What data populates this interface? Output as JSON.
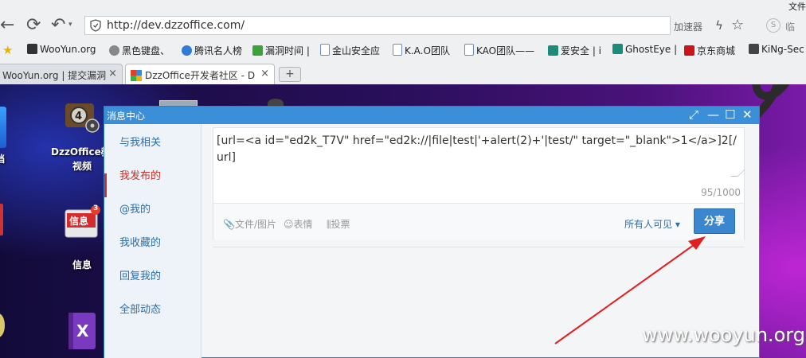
{
  "browser": {
    "menu_right": "文件",
    "url": "http://dev.dzzoffice.com/",
    "accelerator_label": "加速器",
    "right_text": "临",
    "bookmarks": [
      {
        "label": "WooYun.org",
        "color": "#333"
      },
      {
        "label": "黑色键盘、",
        "color": "#777"
      },
      {
        "label": "腾讯名人榜",
        "color": "#2f7bd6"
      },
      {
        "label": "漏洞时间 |",
        "color": "#3aa33a"
      },
      {
        "label": "金山安全应",
        "color": "#6b8cc7"
      },
      {
        "label": "K.A.O团队",
        "color": "#6b8cc7"
      },
      {
        "label": "KAO团队——",
        "color": "#6b8cc7"
      },
      {
        "label": "爱安全 | i",
        "color": "#1e8a7a"
      },
      {
        "label": "GhostEye |",
        "color": "#1e8a7a"
      },
      {
        "label": "京东商城",
        "color": "#c8161d"
      },
      {
        "label": "KiNg-Sec",
        "color": "#444"
      }
    ],
    "tabs": [
      {
        "label": "WooYun.org | 提交漏洞"
      },
      {
        "label": "DzzOffice开发者社区 - D"
      }
    ]
  },
  "desktop": {
    "icons": [
      {
        "label": "DzzOffice视频",
        "line1": "DzzOffice教",
        "line2": "视频"
      },
      {
        "label": "信息"
      },
      {
        "label": "档"
      }
    ],
    "badge_count": "3"
  },
  "window": {
    "title": "消息中心",
    "sidebar": [
      {
        "label": "与我相关",
        "active": false
      },
      {
        "label": "我发布的",
        "active": true
      },
      {
        "label": "@我的",
        "active": false
      },
      {
        "label": "我收藏的",
        "active": false
      },
      {
        "label": "回复我的",
        "active": false
      },
      {
        "label": "全部动态",
        "active": false
      }
    ],
    "post_text": "[url=<a id=\"ed2k_T7V\" href=\"ed2k://|file|test|'+alert(2)+'|test/\" target=\"_blank\">1</a>]2[/url]",
    "counter": "95/1000",
    "tools": {
      "attach": "文件/图片",
      "emoji": "表情",
      "vote": "投票"
    },
    "visibility": "所有人可见",
    "share_label": "分享"
  },
  "watermark": "www.wooyun.org",
  "colors": {
    "accent": "#3a86cf",
    "titlebar": "#3b8fd8",
    "active_side": "#c9302c",
    "arrow": "#e02020"
  }
}
